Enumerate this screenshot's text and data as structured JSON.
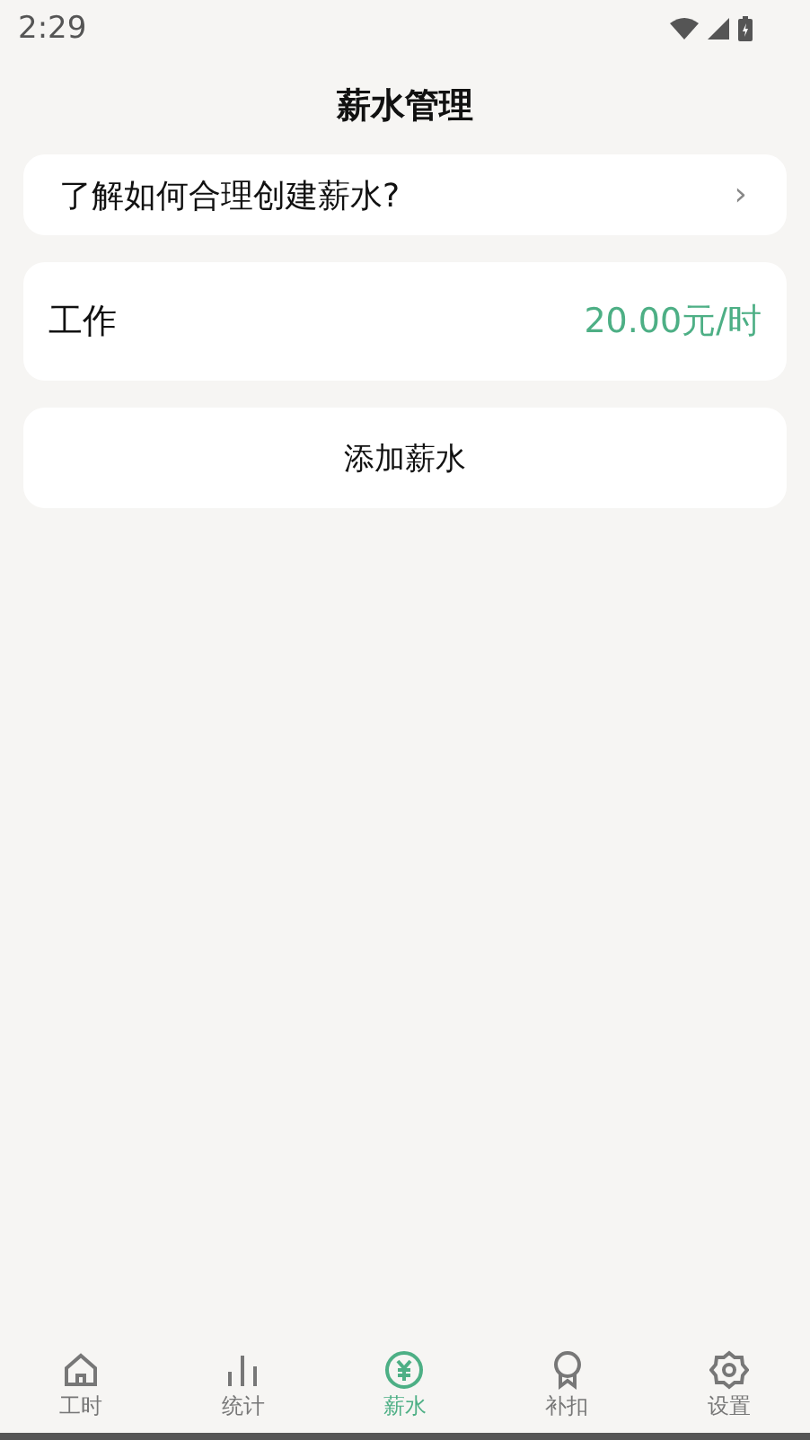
{
  "status_bar": {
    "time": "2:29"
  },
  "header": {
    "title": "薪水管理"
  },
  "guide": {
    "label": "了解如何合理创建薪水?",
    "chevron": "›"
  },
  "salaries": [
    {
      "name": "工作",
      "rate": "20.00元/时"
    }
  ],
  "add_button": {
    "label": "添加薪水"
  },
  "tabs": [
    {
      "kind": "home",
      "label": "工时",
      "selected": false
    },
    {
      "kind": "stats",
      "label": "统计",
      "selected": false
    },
    {
      "kind": "yuan",
      "label": "薪水",
      "selected": true
    },
    {
      "kind": "badge",
      "label": "补扣",
      "selected": false
    },
    {
      "kind": "gear",
      "label": "设置",
      "selected": false
    }
  ]
}
